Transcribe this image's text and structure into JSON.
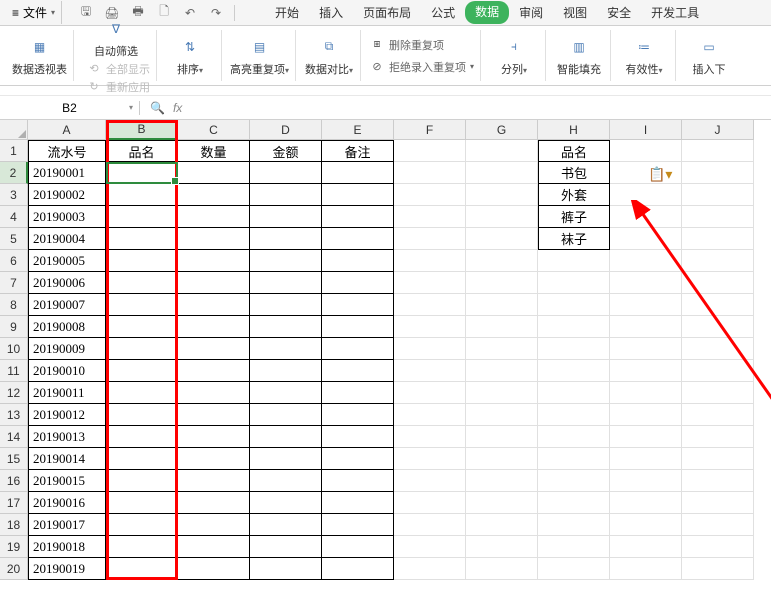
{
  "menubar": {
    "file": "文件",
    "tabs": [
      "开始",
      "插入",
      "页面布局",
      "公式",
      "数据",
      "审阅",
      "视图",
      "安全",
      "开发工具"
    ],
    "active_index": 4
  },
  "ribbon": {
    "pivot": "数据透视表",
    "autofilter": "自动筛选",
    "show_all": "全部显示",
    "reapply": "重新应用",
    "sort": "排序",
    "highlight_dup": "高亮重复项",
    "data_compare": "数据对比",
    "remove_dup": "删除重复项",
    "reject_dup": "拒绝录入重复项",
    "split_col": "分列",
    "smart_fill": "智能填充",
    "validity": "有效性",
    "insert_dd": "插入下"
  },
  "namebox": "B2",
  "columns": [
    "A",
    "B",
    "C",
    "D",
    "E",
    "F",
    "G",
    "H",
    "I",
    "J"
  ],
  "selected_col_index": 1,
  "table_main": {
    "headers": [
      "流水号",
      "品名",
      "数量",
      "金额",
      "备注"
    ],
    "rows": [
      "20190001",
      "20190002",
      "20190003",
      "20190004",
      "20190005",
      "20190006",
      "20190007",
      "20190008",
      "20190009",
      "20190010",
      "20190011",
      "20190012",
      "20190013",
      "20190014",
      "20190015",
      "20190016",
      "20190017",
      "20190018",
      "20190019"
    ]
  },
  "table_side": {
    "header": "品名",
    "items": [
      "书包",
      "外套",
      "裤子",
      "袜子"
    ]
  }
}
